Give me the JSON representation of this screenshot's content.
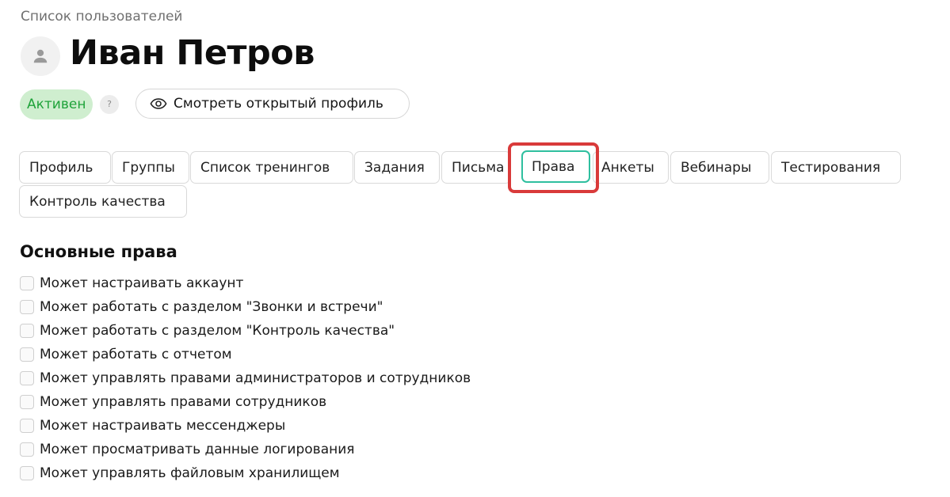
{
  "breadcrumb": "Список пользователей",
  "user": {
    "name": "Иван Петров",
    "avatar_icon": "user-icon"
  },
  "status": {
    "label": "Активен",
    "help": "?",
    "color": "#1fa33a",
    "background": "#cfeecf"
  },
  "profile_button": {
    "label": "Смотреть открытый профиль",
    "icon": "eye-icon"
  },
  "tabs": [
    {
      "label": "Профиль"
    },
    {
      "label": "Группы"
    },
    {
      "label": "Список тренингов"
    },
    {
      "label": "Задания"
    },
    {
      "label": "Письма"
    },
    {
      "label": "Права",
      "active": true
    },
    {
      "label": "Анкеты"
    },
    {
      "label": "Вебинары"
    },
    {
      "label": "Тестирования"
    },
    {
      "label": "Контроль качества"
    }
  ],
  "colors": {
    "active_tab_border": "#2fbf9f",
    "highlight": "#d93a3a"
  },
  "permissions": {
    "title": "Основные права",
    "items": [
      "Может настраивать аккаунт",
      "Может работать с разделом \"Звонки и встречи\"",
      "Может работать с разделом \"Контроль качества\"",
      "Может работать с отчетом",
      "Может управлять правами администраторов и сотрудников",
      "Может управлять правами сотрудников",
      "Может настраивать мессенджеры",
      "Может просматривать данные логирования",
      "Может управлять файловым хранилищем"
    ]
  }
}
